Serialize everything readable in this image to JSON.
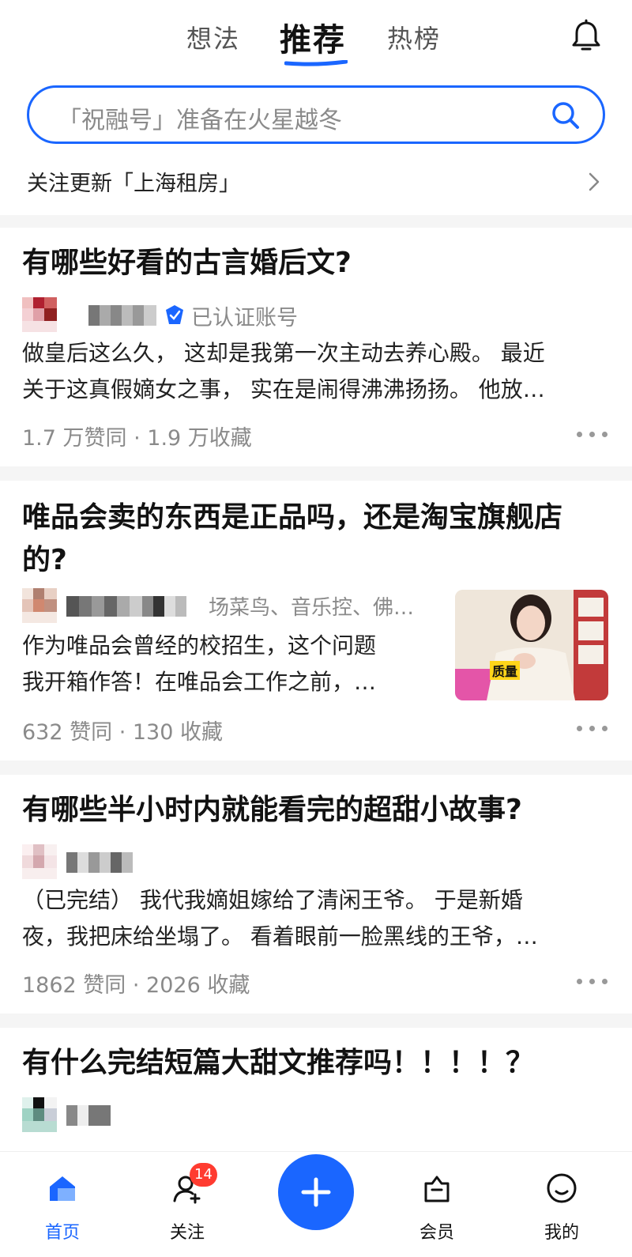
{
  "header": {
    "tabs": [
      {
        "label": "想法",
        "active": false
      },
      {
        "label": "推荐",
        "active": true
      },
      {
        "label": "热榜",
        "active": false
      }
    ],
    "bell_icon": "bell-icon"
  },
  "search": {
    "placeholder": "「祝融号」准备在火星越冬",
    "icon": "search-icon",
    "accent": "#1a66ff"
  },
  "follow_update": {
    "text": "关注更新「上海租房」"
  },
  "feed": [
    {
      "title": "有哪些好看的古言婚后文?",
      "verify_text": "已认证账号",
      "excerpt_lines": [
        "做皇后这么久，  这却是我第一次主动去养心殿。 最近",
        "关于这真假嫡女之事，  实在是闹得沸沸扬扬。 他放…"
      ],
      "stats": "1.7 万赞同 · 1.9 万收藏"
    },
    {
      "title_lines": [
        "唯品会卖的东西是正品吗，还是淘宝旗舰店",
        "的?"
      ],
      "author_tags": "场菜鸟、音乐控、佛…",
      "excerpt_lines": [
        "作为唯品会曾经的校招生，这个问题",
        "我开箱作答！在唯品会工作之前，…"
      ],
      "stats": "632 赞同 · 130 收藏",
      "thumbnail_caption": "质量"
    },
    {
      "title": "有哪些半小时内就能看完的超甜小故事?",
      "excerpt_lines": [
        "（已完结） 我代我嫡姐嫁给了清闲王爷。 于是新婚",
        "夜，我把床给坐塌了。 看着眼前一脸黑线的王爷，…"
      ],
      "stats": "1862 赞同 · 2026 收藏"
    },
    {
      "title": "有什么完结短篇大甜文推荐吗！！！！？"
    }
  ],
  "bottom_nav": {
    "items": [
      {
        "label": "首页",
        "icon": "home-icon",
        "active": true
      },
      {
        "label": "关注",
        "icon": "follow-icon",
        "badge": "14"
      },
      {
        "label": "会员",
        "icon": "vip-icon"
      },
      {
        "label": "我的",
        "icon": "profile-icon"
      }
    ],
    "fab_icon": "plus-icon"
  },
  "colors": {
    "accent": "#1a66ff",
    "badge": "#ff3b30",
    "text_primary": "#121212",
    "text_secondary": "#8a8a8a"
  }
}
